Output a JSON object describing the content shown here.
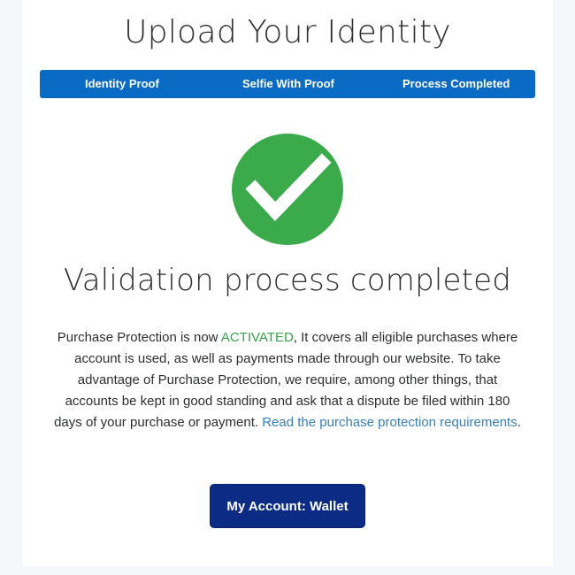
{
  "header": {
    "title": "Upload Your Identity"
  },
  "steps": [
    {
      "label": "Identity Proof"
    },
    {
      "label": "Selfie With Proof"
    },
    {
      "label": "Process Completed"
    }
  ],
  "status": {
    "icon": "check-circle-icon",
    "heading": "Validation process completed"
  },
  "message": {
    "part1": "Purchase Protection is now ",
    "activated": "ACTIVATED",
    "part2": ", It covers all eligible purchases where account is used, as well as payments made through our website. To take advantage of Purchase Protection, we require, among other things, that accounts be kept in good standing and ask that a dispute be filed within 180 days of your purchase or payment. ",
    "link": "Read the purchase protection requirements",
    "end": "."
  },
  "cta": {
    "label": "My Account: Wallet"
  },
  "colors": {
    "step_bar": "#0a6bc4",
    "check_green": "#3aaa4b",
    "activated_green": "#3aa14a",
    "link_blue": "#3b7fb6",
    "button_navy": "#0b2b85"
  }
}
